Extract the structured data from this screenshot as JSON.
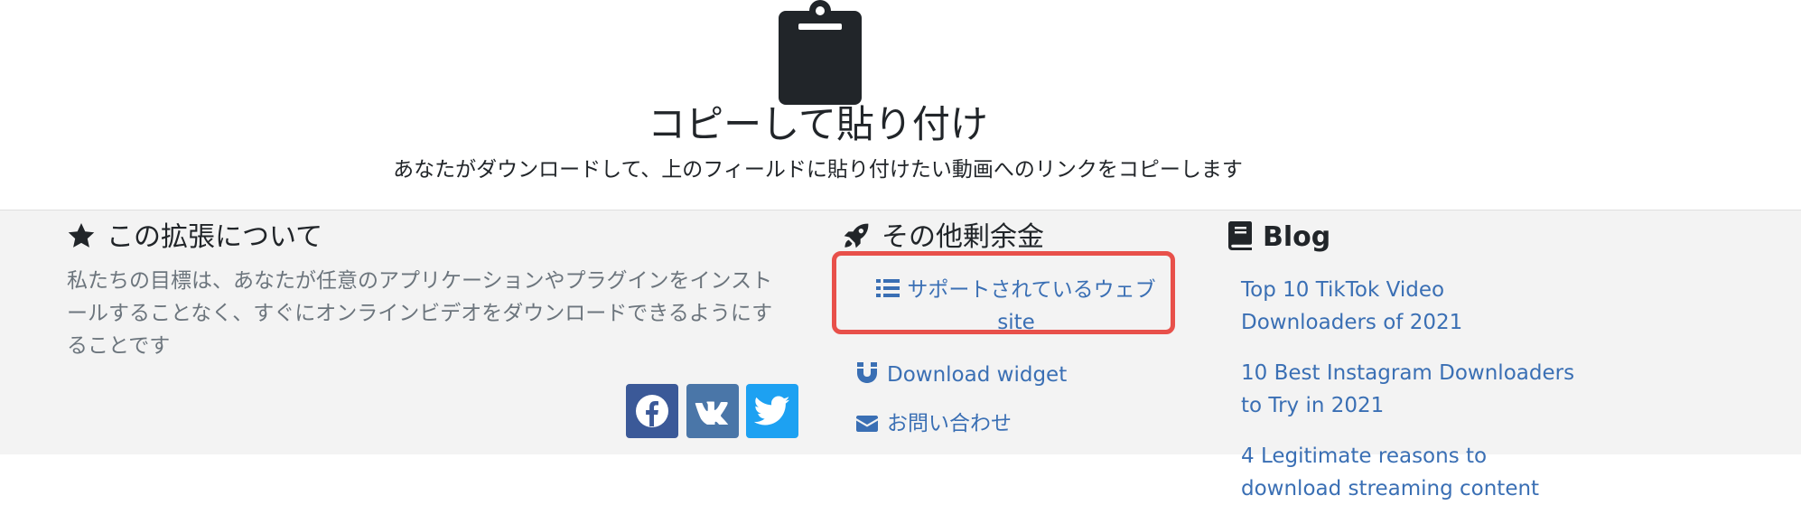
{
  "hero": {
    "title": "コピーして貼り付け",
    "subtitle": "あなたがダウンロードして、上のフィールドに貼り付けたい動画へのリンクをコピーします",
    "icon": "clipboard-icon"
  },
  "footer": {
    "about": {
      "title": "この拡張について",
      "icon": "star-icon",
      "text": "私たちの目標は、あなたが任意のアプリケーションやプラグインをインストールすることなく、すぐにオンラインビデオをダウンロードできるようにすることです"
    },
    "social": [
      {
        "name": "facebook",
        "icon": "facebook-icon",
        "color": "#3b5998"
      },
      {
        "name": "vk",
        "icon": "vk-icon",
        "color": "#4a76a8"
      },
      {
        "name": "twitter",
        "icon": "twitter-icon",
        "color": "#1da1f2"
      }
    ],
    "other": {
      "title": "その他剰余金",
      "icon": "rocket-icon",
      "links": [
        {
          "label": "サポートされているウェブ",
          "label2": "site",
          "icon": "list-icon"
        },
        {
          "label": "Download widget",
          "icon": "magnet-icon"
        },
        {
          "label": "お問い合わせ",
          "icon": "envelope-icon"
        }
      ]
    },
    "blog": {
      "title": "Blog",
      "icon": "book-icon",
      "posts": [
        {
          "line1": "Top 10 TikTok Video",
          "line2": "Downloaders of 2021"
        },
        {
          "line1": "10 Best Instagram Downloaders",
          "line2": "to Try in 2021"
        },
        {
          "line1": "4 Legitimate reasons to",
          "line2": "download streaming content"
        }
      ]
    },
    "colors": {
      "link": "#3a6fb4",
      "highlight": "#e8504a",
      "background": "#f3f3f3"
    }
  }
}
